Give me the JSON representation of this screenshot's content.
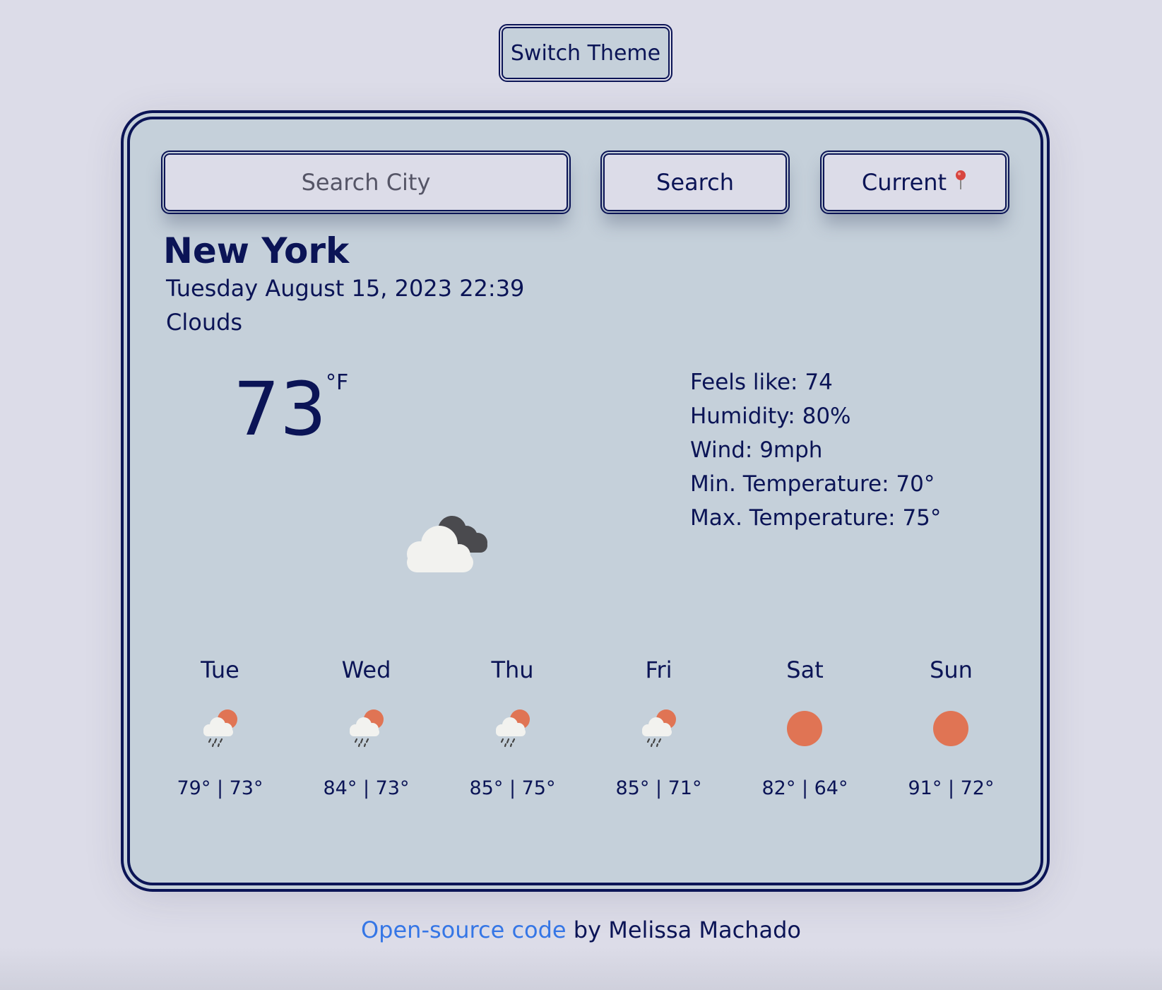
{
  "header": {
    "theme_button_label": "Switch Theme"
  },
  "search": {
    "placeholder": "Search City",
    "search_button_label": "Search",
    "current_button_label": "Current",
    "current_icon": "pin-icon"
  },
  "current": {
    "city": "New York",
    "datetime": "Tuesday August 15, 2023 22:39",
    "description": "Clouds",
    "temperature": "73",
    "unit": "°F",
    "icon": "clouds-icon",
    "details": {
      "feels_like": "Feels like: 74",
      "humidity": "Humidity: 80%",
      "wind": "Wind: 9mph",
      "min_temp": "Min. Temperature: 70°",
      "max_temp": "Max. Temperature: 75°"
    }
  },
  "forecast": [
    {
      "day": "Tue",
      "icon": "rain-sun-icon",
      "range": "79° | 73°"
    },
    {
      "day": "Wed",
      "icon": "rain-sun-icon",
      "range": "84° | 73°"
    },
    {
      "day": "Thu",
      "icon": "rain-sun-icon",
      "range": "85° | 75°"
    },
    {
      "day": "Fri",
      "icon": "rain-sun-icon",
      "range": "85° | 71°"
    },
    {
      "day": "Sat",
      "icon": "sun-icon",
      "range": "82° | 64°"
    },
    {
      "day": "Sun",
      "icon": "sun-icon",
      "range": "91° | 72°"
    }
  ],
  "footer": {
    "link_text": "Open-source code",
    "suffix": " by Melissa Machado"
  },
  "colors": {
    "page_background": "#dcdce8",
    "card_background": "#c5d0da",
    "primary_text": "#0b1456",
    "link": "#3576e6",
    "sun": "#e07454"
  }
}
